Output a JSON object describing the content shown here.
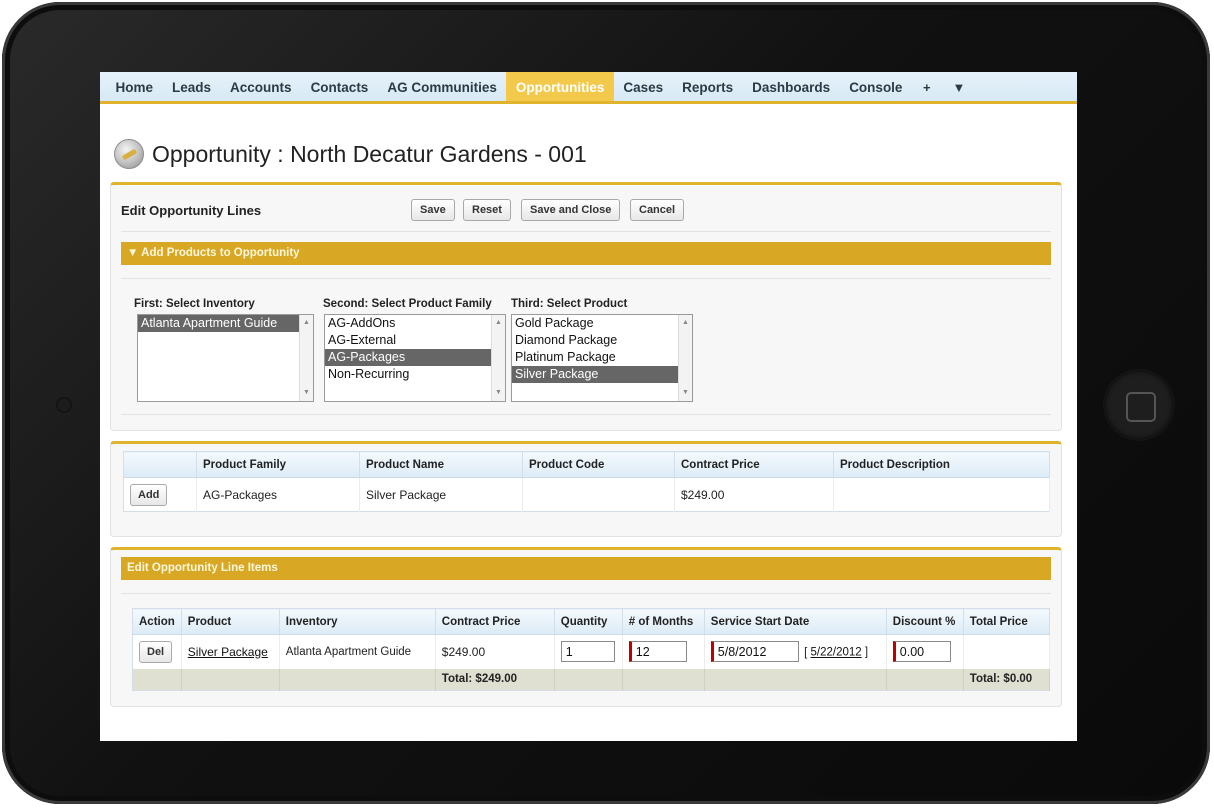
{
  "nav": {
    "tabs": [
      "Home",
      "Leads",
      "Accounts",
      "Contacts",
      "AG Communities",
      "Opportunities",
      "Cases",
      "Reports",
      "Dashboards",
      "Console"
    ],
    "active_tab": "Opportunities",
    "plus_icon": "+",
    "more_icon": "▼"
  },
  "page": {
    "title": "Opportunity : North Decatur Gardens - 001"
  },
  "edit_lines": {
    "title": "Edit Opportunity Lines",
    "buttons": {
      "save": "Save",
      "reset": "Reset",
      "save_close": "Save and Close",
      "cancel": "Cancel"
    }
  },
  "add_products": {
    "section_title": "▼ Add Products to Opportunity",
    "inventory": {
      "label": "First: Select Inventory",
      "options": [
        "Atlanta Apartment Guide"
      ],
      "selected": "Atlanta Apartment Guide"
    },
    "family": {
      "label": "Second: Select Product Family",
      "options": [
        "AG-AddOns",
        "AG-External",
        "AG-Packages",
        "Non-Recurring"
      ],
      "selected": "AG-Packages"
    },
    "product": {
      "label": "Third: Select Product",
      "options": [
        "Gold Package",
        "Diamond Package",
        "Platinum Package",
        "Silver Package"
      ],
      "selected": "Silver Package"
    }
  },
  "product_table": {
    "headers": [
      "",
      "Product Family",
      "Product Name",
      "Product Code",
      "Contract Price",
      "Product Description"
    ],
    "row": {
      "action": "Add",
      "family": "AG-Packages",
      "name": "Silver Package",
      "code": "",
      "price": "$249.00",
      "description": ""
    }
  },
  "line_items": {
    "section_title": "Edit Opportunity Line Items",
    "headers": [
      "Action",
      "Product",
      "Inventory",
      "Contract Price",
      "Quantity",
      "# of Months",
      "Service Start Date",
      "Discount %",
      "Total Price"
    ],
    "row": {
      "action": "Del",
      "product": "Silver Package",
      "inventory": "Atlanta Apartment Guide",
      "price": "$249.00",
      "quantity": "1",
      "months": "12",
      "start_date": "5/8/2012",
      "today_link_open": "[ ",
      "today_link": "5/22/2012",
      "today_link_close": " ]",
      "discount": "0.00",
      "total": ""
    },
    "totals": {
      "price_total": "Total: $249.00",
      "grand_total": "Total: $0.00"
    }
  }
}
